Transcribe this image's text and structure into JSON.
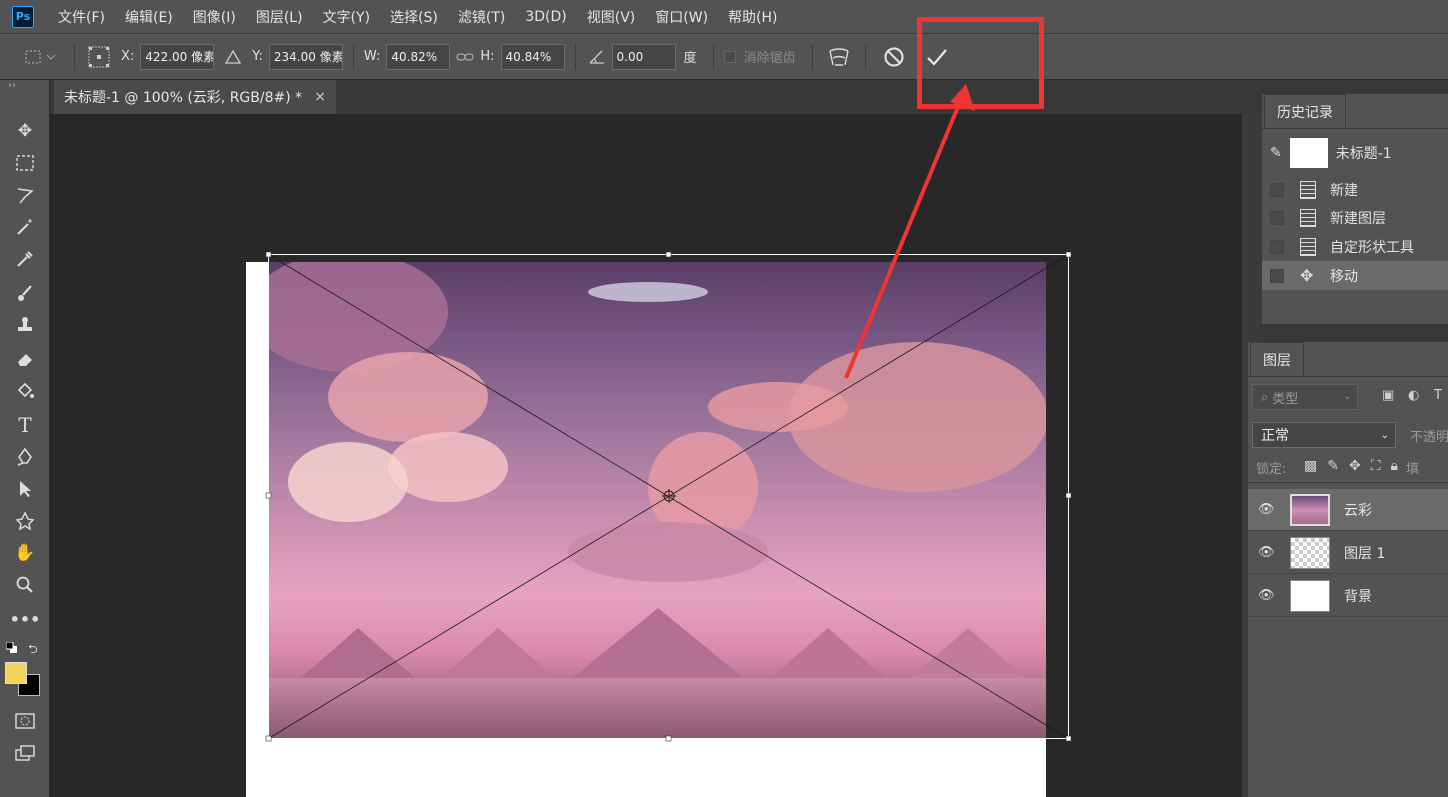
{
  "app": {
    "logo": "Ps"
  },
  "menu": [
    "文件(F)",
    "编辑(E)",
    "图像(I)",
    "图层(L)",
    "文字(Y)",
    "选择(S)",
    "滤镜(T)",
    "3D(D)",
    "视图(V)",
    "窗口(W)",
    "帮助(H)"
  ],
  "options": {
    "x_label": "X:",
    "x_value": "422.00 像素",
    "y_label": "Y:",
    "y_value": "234.00 像素",
    "w_label": "W:",
    "w_value": "40.82%",
    "h_label": "H:",
    "h_value": "40.84%",
    "angle_value": "0.00",
    "angle_unit": "度",
    "antialias_label": "消除锯齿",
    "cancel_icon": "cancel-icon",
    "commit_icon": "checkmark-icon"
  },
  "document_tab": {
    "title": "未标题-1 @ 100% (云彩, RGB/8#) *",
    "close": "×"
  },
  "history": {
    "tab": "历史记录",
    "snapshot": "未标题-1",
    "items": [
      "新建",
      "新建图层",
      "自定形状工具",
      "移动"
    ],
    "active_index": 3
  },
  "layers": {
    "tab": "图层",
    "filter_placeholder": "类型",
    "blend_mode": "正常",
    "opacity_label": "不透明度",
    "lock_label": "锁定:",
    "fill_label": "填",
    "items": [
      {
        "name": "云彩",
        "thumb": "sky",
        "active": true
      },
      {
        "name": "图层 1",
        "thumb": "transparent",
        "active": false
      },
      {
        "name": "背景",
        "thumb": "white",
        "active": false
      }
    ]
  },
  "colors": {
    "foreground": "#f2d35a",
    "background": "#000000",
    "annotation": "#f03434",
    "accent": "#31a8ff"
  }
}
